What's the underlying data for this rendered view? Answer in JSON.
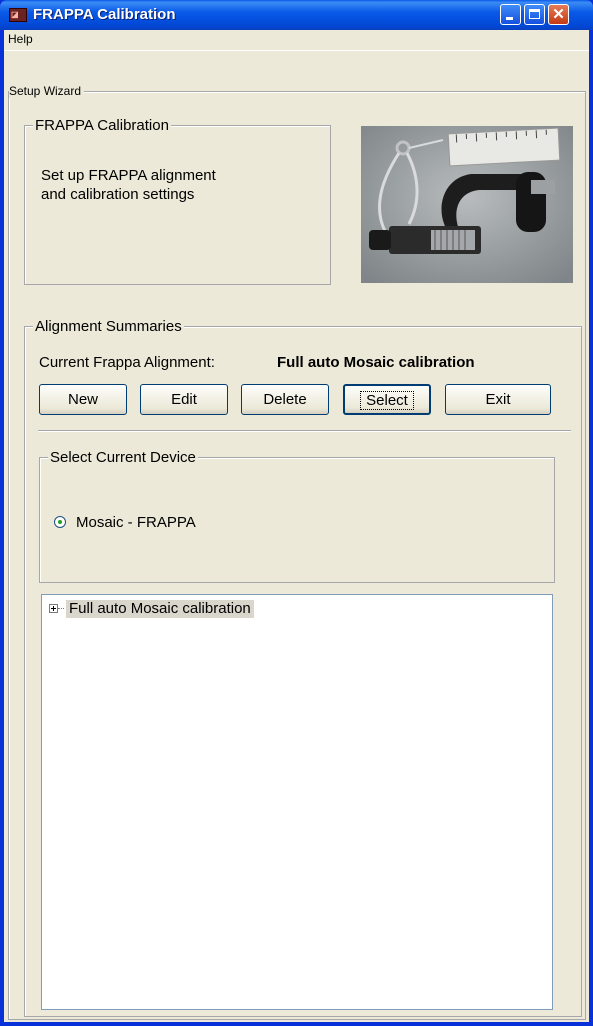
{
  "window": {
    "title": "FRAPPA Calibration"
  },
  "menu": {
    "help": "Help"
  },
  "setup_wizard": {
    "label": "Setup Wizard",
    "calibration_group": {
      "title": "FRAPPA Calibration",
      "description_line1": "Set up FRAPPA alignment",
      "description_line2": "and calibration settings"
    },
    "image_icon": "calibration-tools-image"
  },
  "alignment_summaries": {
    "title": "Alignment Summaries",
    "current_label": "Current Frappa Alignment:",
    "current_value": "Full auto Mosaic calibration",
    "buttons": {
      "new": "New",
      "edit": "Edit",
      "delete": "Delete",
      "select": "Select",
      "exit": "Exit"
    }
  },
  "device_group": {
    "title": "Select Current Device",
    "option_label": "Mosaic - FRAPPA",
    "option_selected": true
  },
  "tree": {
    "items": [
      {
        "label": "Full auto Mosaic calibration",
        "expanded": false
      }
    ]
  }
}
